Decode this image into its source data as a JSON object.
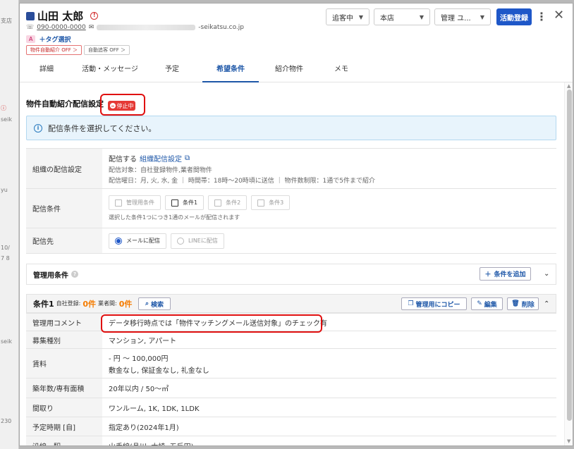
{
  "background": {
    "snippets": [
      "支店",
      "seik",
      "yu",
      "10/",
      "7 8",
      "seik",
      "230"
    ]
  },
  "header": {
    "name": "山田 太郎",
    "phone": "090-0000-0000",
    "email_domain": "-seikatsu.co.jp",
    "tag_badge": "A",
    "tag_select": "＋タグ選択",
    "chips": [
      "物件自動紹介 OFF ＞",
      "自動追客 OFF ＞"
    ],
    "status_select": "追客中",
    "branch_select": "本店",
    "manager_select": "管理 ユ...",
    "action_button": "活動登録",
    "kebab": "⋮",
    "close": "✕"
  },
  "tabs": [
    "詳細",
    "活動・メッセージ",
    "予定",
    "希望条件",
    "紹介物件",
    "メモ"
  ],
  "active_tab_index": 3,
  "section": {
    "title": "物件自動紹介配信設定",
    "stop_badge": "停止中",
    "info_text": "配信条件を選択してください。"
  },
  "settings": {
    "org_label": "組織の配信設定",
    "org_value": "配信する",
    "org_link": "組織配信設定",
    "org_target": "配信対象：自社登録物件,業者間物件",
    "org_schedule": "配信曜日：月, 火, 水, 金 ｜ 時間帯：18時〜20時頃に送信 ｜ 物件数制限：1通で5件まで紹介",
    "cond_label": "配信条件",
    "cond_options": [
      {
        "label": "管理用条件",
        "checked": false
      },
      {
        "label": "条件1",
        "checked": true
      },
      {
        "label": "条件2",
        "checked": false
      },
      {
        "label": "条件3",
        "checked": false
      }
    ],
    "cond_note": "選択した条件1つにつき1通のメールが配信されます",
    "dest_label": "配信先",
    "dest_options": [
      {
        "label": "メールに配信",
        "selected": true
      },
      {
        "label": "LINEに配信",
        "selected": false
      }
    ]
  },
  "kanri": {
    "title": "管理用条件",
    "help": "?",
    "add_button": "条件を追加",
    "collapse": "⌄"
  },
  "condition1": {
    "title": "条件1",
    "self_label": "自社登録:",
    "self_count": "0件",
    "broker_label": "業者間:",
    "broker_count": "0件",
    "search_button": "検索",
    "copy_button": "管理用にコピー",
    "edit_button": "編集",
    "delete_button": "削除",
    "collapse": "⌃",
    "rows": [
      {
        "label": "管理用コメント",
        "value": "データ移行時点では「物件マッチングメール送信対象」のチェック有"
      },
      {
        "label": "募集種別",
        "value": "マンション, アパート"
      },
      {
        "label": "賃料",
        "value": "- 円 〜 100,000円",
        "value2": "敷金なし, 保証金なし, 礼金なし"
      },
      {
        "label": "築年数/専有面積",
        "value": "20年以内 / 50〜㎡"
      },
      {
        "label": "間取り",
        "value": "ワンルーム, 1K, 1DK, 1LDK"
      },
      {
        "label": "予定時期 [自]",
        "value": "指定あり(2024年1月)"
      },
      {
        "label": "沿線・駅",
        "value": "山手線(品川, 大崎, 五反田)"
      }
    ]
  }
}
